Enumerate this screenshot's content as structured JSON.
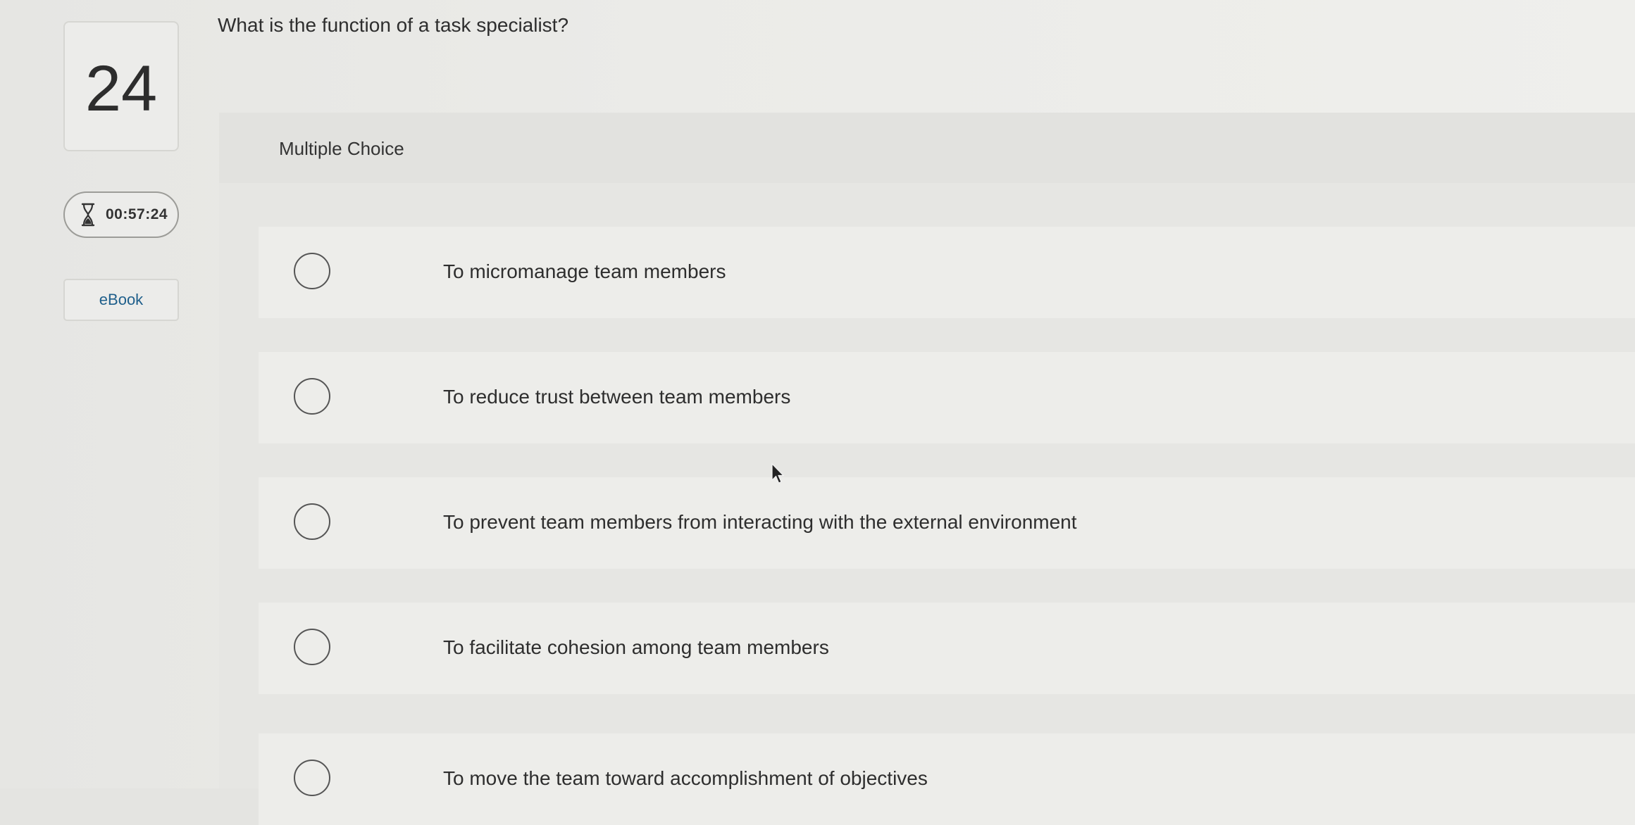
{
  "question": {
    "number": "24",
    "text": "What is the function of a task specialist?",
    "type_label": "Multiple Choice"
  },
  "timer": {
    "icon": "hourglass-icon",
    "value": "00:57:24"
  },
  "ebook": {
    "label": "eBook"
  },
  "choices": [
    {
      "label": "To micromanage team members"
    },
    {
      "label": "To reduce trust between team members"
    },
    {
      "label": "To prevent team members from interacting with the external environment"
    },
    {
      "label": "To facilitate cohesion among team members"
    },
    {
      "label": "To move the team toward accomplishment of objectives"
    }
  ]
}
